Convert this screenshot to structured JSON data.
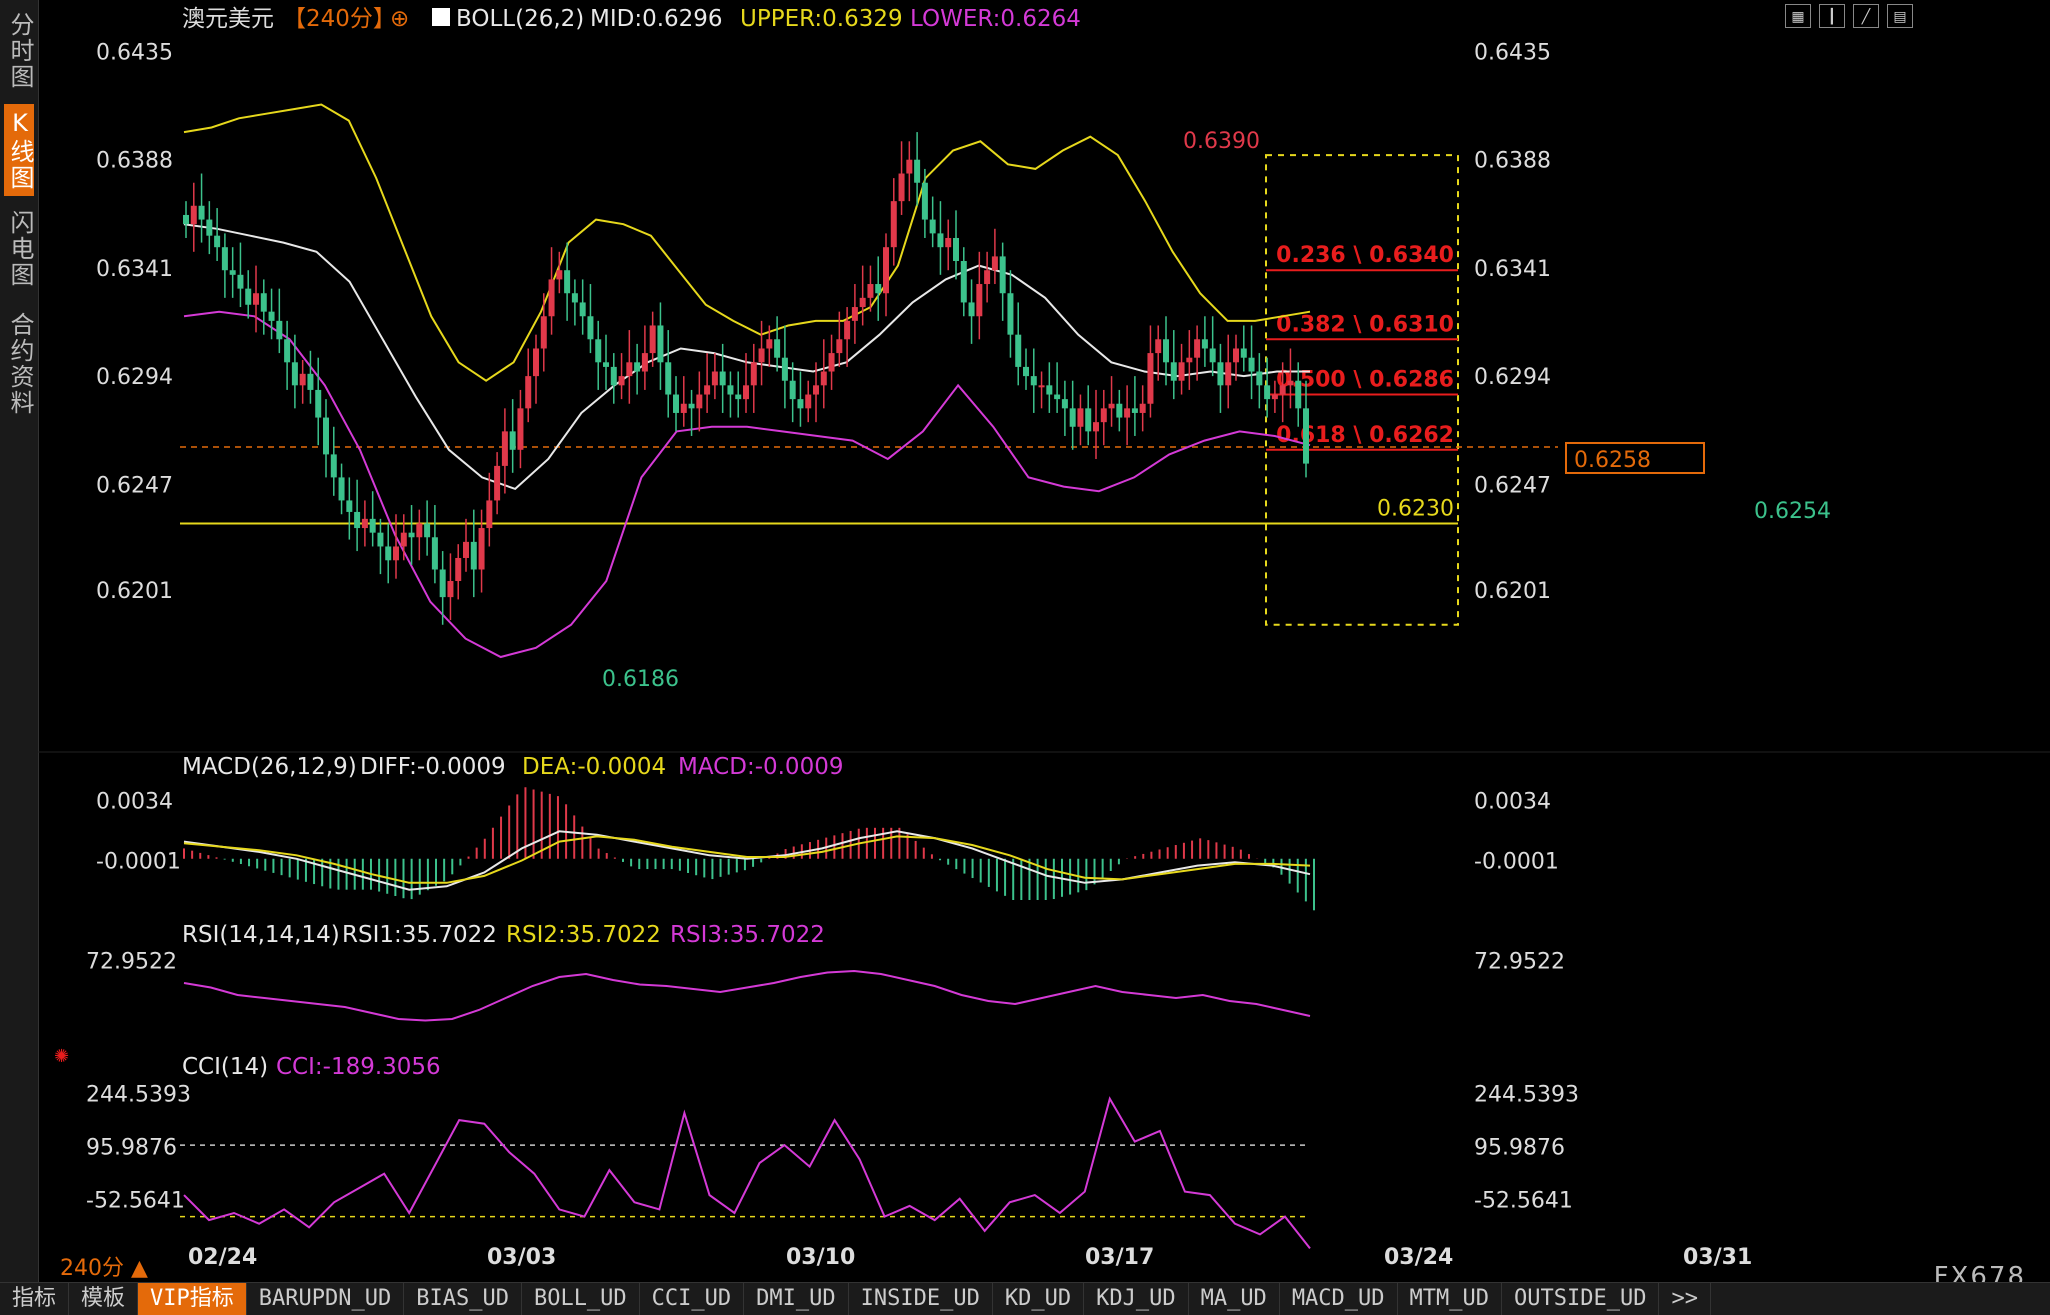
{
  "sidebar": {
    "tabs": [
      {
        "label": "分时图"
      },
      {
        "label": "K线图"
      },
      {
        "label": "闪电图"
      },
      {
        "label": "合约资料"
      }
    ]
  },
  "header": {
    "symbol": "澳元美元",
    "period_tag": "【240分】",
    "boll": "BOLL(26,2)",
    "mid": "MID:0.6296",
    "upper": "UPPER:0.6329",
    "lower": "LOWER:0.6264"
  },
  "macd_header": {
    "name": "MACD(26,12,9)",
    "diff": "DIFF:-0.0009",
    "dea": "DEA:-0.0004",
    "macd": "MACD:-0.0009"
  },
  "rsi_header": {
    "name": "RSI(14,14,14)",
    "rsi1": "RSI1:35.7022",
    "rsi2": "RSI2:35.7022",
    "rsi3": "RSI3:35.7022"
  },
  "cci_header": {
    "name": "CCI(14)",
    "cci": "CCI:-189.3056"
  },
  "period_label": "240分 ▲",
  "brand": "FX678",
  "bottom_tabs": [
    "指标",
    "模板",
    "VIP指标",
    "BARUPDN_UD",
    "BIAS_UD",
    "BOLL_UD",
    "CCI_UD",
    "DMI_UD",
    "INSIDE_UD",
    "KD_UD",
    "KDJ_UD",
    "MA_UD",
    "MACD_UD",
    "MTM_UD",
    "OUTSIDE_UD",
    ">>"
  ],
  "toolbar_icons": [
    "grid-icon",
    "candle-icon",
    "line-icon",
    "bar-icon"
  ],
  "colors": {
    "up": "#e0394a",
    "down": "#3cc28c",
    "upper": "#e6d81c",
    "mid": "#e8e8e8",
    "lower": "#d43ad6",
    "fib": "#e81d1d",
    "accent": "#e46a0a"
  },
  "chart_data": [
    {
      "type": "candlestick",
      "title": "澳元美元 240分",
      "y_ticks": [
        "0.6435",
        "0.6388",
        "0.6341",
        "0.6294",
        "0.6247",
        "0.6201"
      ],
      "ylim": [
        0.6162,
        0.644
      ],
      "x_labels": [
        "02/24",
        "03/03",
        "03/10",
        "03/17",
        "03/24",
        "03/31"
      ],
      "current_price": "0.6258",
      "support_line": "0.6230",
      "annotations": {
        "high": "0.6390",
        "low": "0.6186",
        "last_low": "0.6254"
      },
      "fib_levels": [
        {
          "label": "0.236 \\ 0.6340",
          "value": 0.634
        },
        {
          "label": "0.382 \\ 0.6310",
          "value": 0.631
        },
        {
          "label": "0.500 \\ 0.6286",
          "value": 0.6286
        },
        {
          "label": "0.618 \\ 0.6262",
          "value": 0.6262
        }
      ],
      "fib_box": {
        "top": 0.639,
        "bottom": 0.6186
      },
      "close_series": [
        0.636,
        0.6368,
        0.6362,
        0.6355,
        0.635,
        0.634,
        0.6338,
        0.6332,
        0.6325,
        0.633,
        0.6322,
        0.6318,
        0.631,
        0.63,
        0.629,
        0.6295,
        0.6288,
        0.6276,
        0.626,
        0.625,
        0.624,
        0.6235,
        0.6228,
        0.6232,
        0.6226,
        0.622,
        0.6214,
        0.622,
        0.6226,
        0.6224,
        0.623,
        0.6224,
        0.621,
        0.6198,
        0.6205,
        0.6215,
        0.6222,
        0.621,
        0.6228,
        0.624,
        0.6255,
        0.627,
        0.6262,
        0.628,
        0.6294,
        0.6306,
        0.632,
        0.6336,
        0.634,
        0.633,
        0.6326,
        0.632,
        0.631,
        0.63,
        0.6298,
        0.629,
        0.6294,
        0.63,
        0.6296,
        0.6304,
        0.6316,
        0.63,
        0.6286,
        0.6278,
        0.6282,
        0.628,
        0.6286,
        0.629,
        0.6296,
        0.629,
        0.6286,
        0.6284,
        0.629,
        0.63,
        0.6306,
        0.631,
        0.6302,
        0.6292,
        0.6284,
        0.628,
        0.6286,
        0.629,
        0.6296,
        0.6304,
        0.631,
        0.6318,
        0.6324,
        0.6328,
        0.6334,
        0.633,
        0.635,
        0.637,
        0.6382,
        0.6388,
        0.6378,
        0.6362,
        0.6356,
        0.635,
        0.6354,
        0.6344,
        0.6326,
        0.632,
        0.6334,
        0.634,
        0.6346,
        0.633,
        0.6312,
        0.6298,
        0.6294,
        0.629,
        0.629,
        0.6286,
        0.6284,
        0.628,
        0.6272,
        0.628,
        0.627,
        0.6274,
        0.628,
        0.6282,
        0.6276,
        0.628,
        0.6278,
        0.6282,
        0.6304,
        0.631,
        0.63,
        0.6292,
        0.63,
        0.6302,
        0.631,
        0.6306,
        0.63,
        0.629,
        0.63,
        0.6306,
        0.6302,
        0.6296,
        0.629,
        0.6284,
        0.6286,
        0.629,
        0.6292,
        0.628,
        0.6256
      ],
      "boll_upper": [
        0.64,
        0.6402,
        0.6406,
        0.6408,
        0.641,
        0.6412,
        0.6405,
        0.638,
        0.635,
        0.632,
        0.63,
        0.6292,
        0.63,
        0.6322,
        0.6352,
        0.6362,
        0.636,
        0.6355,
        0.634,
        0.6325,
        0.6318,
        0.6312,
        0.6316,
        0.6318,
        0.6318,
        0.6324,
        0.6342,
        0.638,
        0.6392,
        0.6396,
        0.6386,
        0.6384,
        0.6392,
        0.6398,
        0.639,
        0.637,
        0.6348,
        0.633,
        0.6318,
        0.6318,
        0.632,
        0.6322
      ],
      "boll_mid": [
        0.636,
        0.6358,
        0.6355,
        0.6352,
        0.6348,
        0.6335,
        0.631,
        0.6285,
        0.6262,
        0.625,
        0.6245,
        0.6258,
        0.6278,
        0.629,
        0.63,
        0.6306,
        0.6304,
        0.63,
        0.6298,
        0.6296,
        0.63,
        0.6312,
        0.6326,
        0.6336,
        0.6342,
        0.6338,
        0.6328,
        0.6312,
        0.63,
        0.6296,
        0.6294,
        0.6296,
        0.6294,
        0.6296,
        0.6296
      ],
      "boll_lower": [
        0.632,
        0.6322,
        0.632,
        0.631,
        0.629,
        0.6262,
        0.6225,
        0.6196,
        0.618,
        0.6172,
        0.6176,
        0.6186,
        0.6205,
        0.625,
        0.627,
        0.6272,
        0.6272,
        0.627,
        0.6268,
        0.6266,
        0.6258,
        0.627,
        0.629,
        0.6272,
        0.625,
        0.6246,
        0.6244,
        0.625,
        0.626,
        0.6266,
        0.627,
        0.6268,
        0.6264
      ]
    },
    {
      "type": "line",
      "title": "MACD(26,12,9)",
      "y_ticks": [
        "0.0034",
        "-0.0001"
      ],
      "ylim": [
        -0.0024,
        0.004
      ],
      "series": [
        {
          "name": "DIFF",
          "values": [
            0.001,
            0.0007,
            0.0004,
            0.0,
            -0.0006,
            -0.0012,
            -0.0018,
            -0.0016,
            -0.0008,
            0.0006,
            0.0016,
            0.0014,
            0.001,
            0.0006,
            0.0002,
            0.0,
            0.0002,
            0.0006,
            0.0012,
            0.0016,
            0.0012,
            0.0006,
            -0.0002,
            -0.001,
            -0.0014,
            -0.0012,
            -0.0008,
            -0.0004,
            -0.0002,
            -0.0004,
            -0.0009
          ]
        },
        {
          "name": "DEA",
          "values": [
            0.0009,
            0.0007,
            0.0005,
            0.0002,
            -0.0003,
            -0.0009,
            -0.0014,
            -0.0014,
            -0.001,
            -0.0001,
            0.001,
            0.0013,
            0.0011,
            0.0007,
            0.0004,
            0.0001,
            0.0001,
            0.0004,
            0.0009,
            0.0013,
            0.0012,
            0.0008,
            0.0002,
            -0.0006,
            -0.0011,
            -0.0012,
            -0.0009,
            -0.0006,
            -0.0003,
            -0.0003,
            -0.0004
          ]
        }
      ]
    },
    {
      "type": "line",
      "title": "RSI(14,14,14)",
      "y_ticks": [
        "72.9522"
      ],
      "ylim": [
        20,
        80
      ],
      "series": [
        {
          "name": "RSI1",
          "values": [
            58,
            55,
            50,
            48,
            46,
            44,
            42,
            38,
            34,
            33,
            34,
            40,
            48,
            56,
            62,
            64,
            60,
            57,
            56,
            54,
            52,
            55,
            58,
            62,
            65,
            66,
            64,
            60,
            56,
            50,
            46,
            44,
            48,
            52,
            56,
            52,
            50,
            48,
            50,
            46,
            44,
            40,
            36
          ]
        }
      ]
    },
    {
      "type": "line",
      "title": "CCI(14)",
      "y_ticks": [
        "244.5393",
        "95.9876",
        "-52.5641"
      ],
      "ylim": [
        -160,
        260
      ],
      "series": [
        {
          "name": "CCI",
          "values": [
            -40,
            -110,
            -90,
            -120,
            -80,
            -130,
            -60,
            -20,
            20,
            -90,
            40,
            170,
            160,
            80,
            20,
            -80,
            -100,
            30,
            -60,
            -80,
            190,
            -40,
            -90,
            50,
            100,
            40,
            170,
            60,
            -100,
            -70,
            -110,
            -50,
            -140,
            -60,
            -40,
            -90,
            -30,
            230,
            110,
            140,
            -30,
            -40,
            -120,
            -150,
            -100,
            -189
          ]
        }
      ]
    }
  ]
}
